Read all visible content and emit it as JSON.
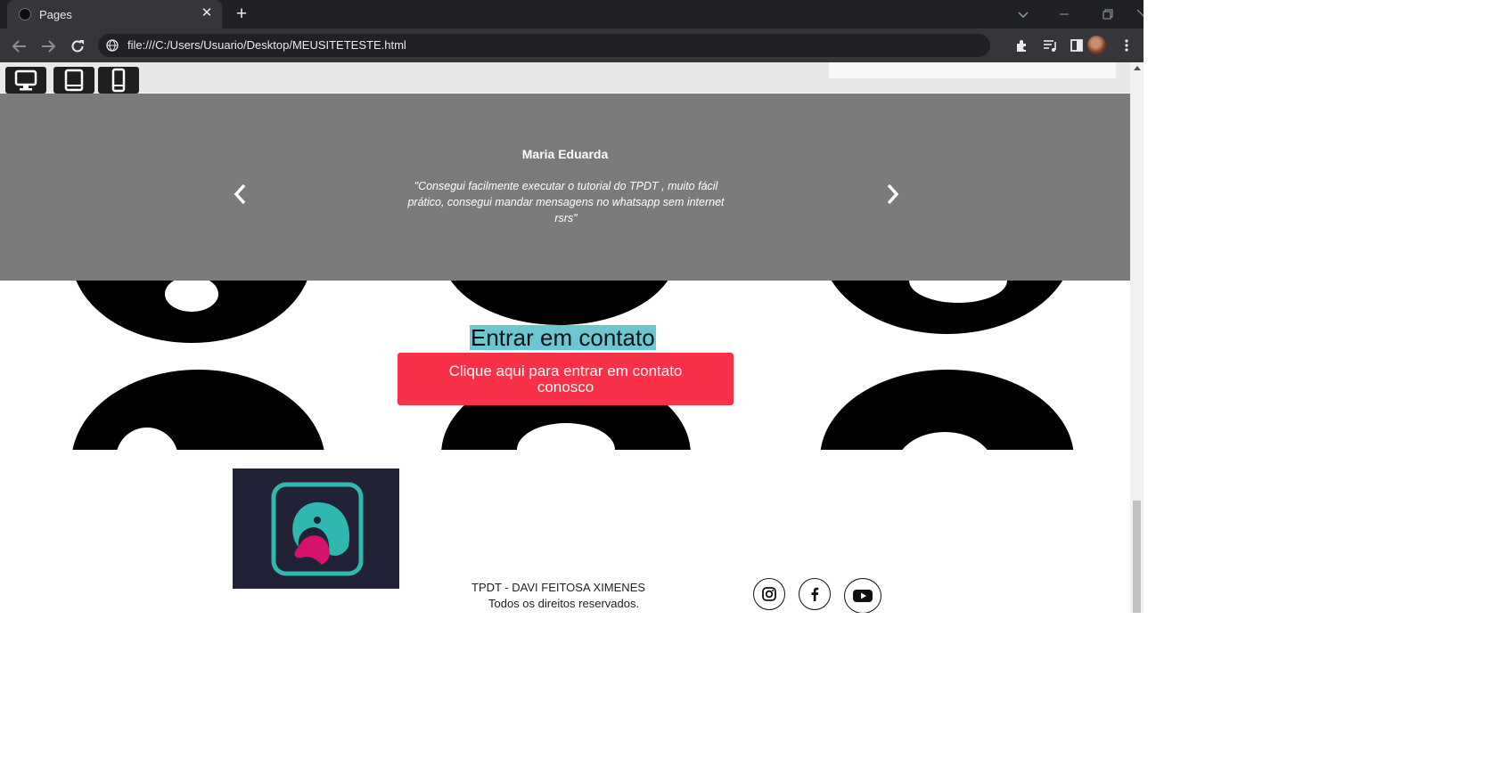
{
  "browser": {
    "tab_title": "Pages",
    "url": "file:///C:/Users/Usuario/Desktop/MEUSITETESTE.html"
  },
  "device_switcher": {
    "items": [
      "desktop-icon",
      "tablet-icon",
      "mobile-icon"
    ]
  },
  "testimonial": {
    "name": "Maria Eduarda",
    "quote": "\"Consegui facilmente executar o tutorial do TPDT , muito fácil prático, consegui mandar mensagens no whatsapp sem internet rsrs\"",
    "background_color": "#7d7b79"
  },
  "contact": {
    "title": "Entrar em contato",
    "button_label": "Clique aqui para entrar em contato conosco",
    "button_color": "#f73248",
    "title_highlight_color": "#6cc7d2"
  },
  "footer": {
    "credit": "TPDT - DAVI FEITOSA XIMENES",
    "rights": "Todos os direitos reservados.",
    "social": [
      "instagram-icon",
      "facebook-icon",
      "youtube-icon"
    ]
  }
}
